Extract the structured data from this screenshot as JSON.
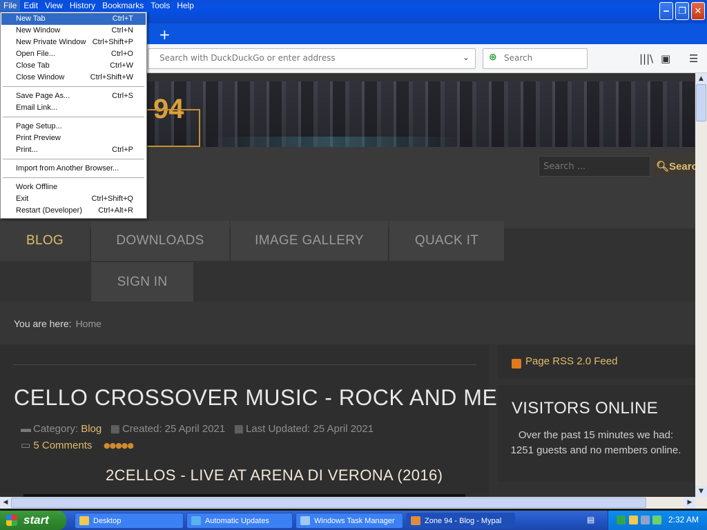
{
  "menubar": [
    "File",
    "Edit",
    "View",
    "History",
    "Bookmarks",
    "Tools",
    "Help"
  ],
  "window_buttons": {
    "minimize": "‒",
    "maximize": "❐",
    "close": "✕"
  },
  "new_tab_symbol": "+",
  "urlbar": {
    "placeholder": "Search with DuckDuckGo or enter address"
  },
  "searchbar": {
    "placeholder": "Search"
  },
  "file_menu": [
    {
      "label": "New Tab",
      "shortcut": "Ctrl+T",
      "highlighted": true
    },
    {
      "label": "New Window",
      "shortcut": "Ctrl+N"
    },
    {
      "label": "New Private Window",
      "shortcut": "Ctrl+Shift+P"
    },
    {
      "label": "Open File...",
      "shortcut": "Ctrl+O"
    },
    {
      "label": "Close Tab",
      "shortcut": "Ctrl+W"
    },
    {
      "label": "Close Window",
      "shortcut": "Ctrl+Shift+W"
    },
    {
      "label": "Save Page As...",
      "shortcut": "Ctrl+S"
    },
    {
      "label": "Email Link...",
      "shortcut": ""
    },
    {
      "label": "Page Setup...",
      "shortcut": ""
    },
    {
      "label": "Print Preview",
      "shortcut": ""
    },
    {
      "label": "Print...",
      "shortcut": "Ctrl+P"
    },
    {
      "label": "Import from Another Browser...",
      "shortcut": ""
    },
    {
      "label": "Work Offline",
      "shortcut": ""
    },
    {
      "label": "Exit",
      "shortcut": "Ctrl+Shift+Q"
    },
    {
      "label": "Restart (Developer)",
      "shortcut": "Ctrl+Alt+R"
    }
  ],
  "site": {
    "logo_text": "94",
    "nav": [
      "BLOG",
      "DOWNLOADS",
      "IMAGE GALLERY",
      "QUACK IT",
      "SIGN IN"
    ],
    "search_placeholder": "Search ...",
    "search_button": "Search",
    "breadcrumb_label": "You are here:",
    "breadcrumb_home": "Home"
  },
  "article": {
    "title": "CELLO CROSSOVER MUSIC - ROCK AND METAL",
    "category_label": "Category:",
    "category": "Blog",
    "created": "Created: 25 April 2021",
    "updated": "Last Updated: 25 April 2021",
    "comments": "5 Comments",
    "subtitle": "2CELLOS - LIVE AT ARENA DI VERONA (2016)"
  },
  "sidebar": {
    "rss": "Page RSS 2.0 Feed",
    "visitors_title": "VISITORS ONLINE",
    "visitors_text": "Over the past 15 minutes we had: 1251 guests and no members online."
  },
  "taskbar": {
    "start": "start",
    "tasks": [
      "Desktop",
      "Automatic Updates",
      "Windows Task Manager",
      "Zone 94 - Blog - Mypal"
    ],
    "clock": "2:32 AM"
  },
  "colors": {
    "accent": "#e3bb6b",
    "titlebar": "#0650e6",
    "menu_highlight": "#316ac5"
  }
}
